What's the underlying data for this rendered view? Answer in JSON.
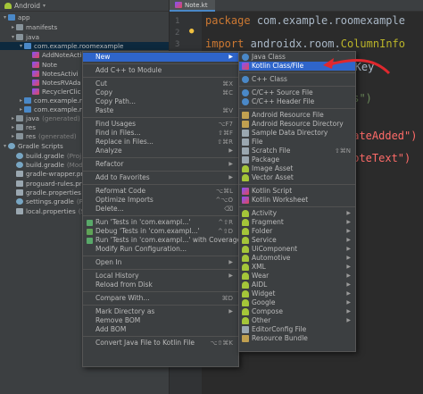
{
  "project": {
    "header": "Android",
    "tree": [
      {
        "label": "app",
        "level": 0
      },
      {
        "label": "manifests",
        "level": 1
      },
      {
        "label": "java",
        "level": 1
      },
      {
        "label": "com.example.roomexample",
        "level": 2
      },
      {
        "label": "AddNoteActi",
        "level": 3
      },
      {
        "label": "Note",
        "level": 3
      },
      {
        "label": "NotesActivi",
        "level": 3
      },
      {
        "label": "NotesRVAda",
        "level": 3
      },
      {
        "label": "RecyclerClic",
        "level": 3
      },
      {
        "label": "com.example.roo",
        "level": 2
      },
      {
        "label": "com.example.roo",
        "level": 2
      },
      {
        "label": "java",
        "suffix": "(generated)",
        "level": 1
      },
      {
        "label": "res",
        "level": 1
      },
      {
        "label": "res",
        "suffix": "(generated)",
        "level": 1
      },
      {
        "label": "Gradle Scripts",
        "level": 0
      },
      {
        "label": "build.gradle",
        "suffix": "(Proj",
        "level": 1
      },
      {
        "label": "build.gradle",
        "suffix": "(Modu",
        "level": 1
      },
      {
        "label": "gradle-wrapper.pr",
        "level": 1
      },
      {
        "label": "proguard-rules.pr",
        "level": 1
      },
      {
        "label": "gradle.properties",
        "level": 1
      },
      {
        "label": "settings.gradle",
        "suffix": "(Pr",
        "level": 1
      },
      {
        "label": "local.properties",
        "suffix": "(S",
        "level": 1
      }
    ]
  },
  "editor": {
    "tab": "Note.kt",
    "line_numbers": [
      "1",
      "2",
      "3"
    ],
    "code": {
      "pkg_kw": "package",
      "pkg_name": "com.example.roomexample",
      "import_kw": "import",
      "import_pkg": "androidx.room.",
      "import_cls": "ColumnInfo",
      "frag_ty": "ty",
      "frag_key": "aryKey",
      "frag_es": "es\")",
      "frag_date": "dateAdded\")",
      "frag_note": "noteText\")"
    }
  },
  "context_menu": {
    "items": [
      {
        "label": "New",
        "submenu": true,
        "active": true
      },
      {
        "sep": true
      },
      {
        "label": "Add C++ to Module"
      },
      {
        "sep": true
      },
      {
        "label": "Cut",
        "shortcut": "⌘X"
      },
      {
        "label": "Copy",
        "shortcut": "⌘C"
      },
      {
        "label": "Copy Path..."
      },
      {
        "label": "Paste",
        "shortcut": "⌘V"
      },
      {
        "sep": true
      },
      {
        "label": "Find Usages",
        "shortcut": "⌥F7"
      },
      {
        "label": "Find in Files...",
        "shortcut": "⇧⌘F"
      },
      {
        "label": "Replace in Files...",
        "shortcut": "⇧⌘R"
      },
      {
        "label": "Analyze",
        "submenu": true
      },
      {
        "sep": true
      },
      {
        "label": "Refactor",
        "submenu": true
      },
      {
        "sep": true
      },
      {
        "label": "Add to Favorites",
        "submenu": true
      },
      {
        "sep": true
      },
      {
        "label": "Reformat Code",
        "shortcut": "⌥⌘L"
      },
      {
        "label": "Optimize Imports",
        "shortcut": "^⌥O"
      },
      {
        "label": "Delete...",
        "shortcut": "⌫"
      },
      {
        "sep": true
      },
      {
        "label": "Run 'Tests in 'com.exampl...'",
        "shortcut": "^⇧R"
      },
      {
        "label": "Debug 'Tests in 'com.exampl...'",
        "shortcut": "^⇧D"
      },
      {
        "label": "Run 'Tests in 'com.exampl...' with Coverage"
      },
      {
        "label": "Modify Run Configuration..."
      },
      {
        "sep": true
      },
      {
        "label": "Open In",
        "submenu": true
      },
      {
        "sep": true
      },
      {
        "label": "Local History",
        "submenu": true
      },
      {
        "label": "Reload from Disk"
      },
      {
        "sep": true
      },
      {
        "label": "Compare With...",
        "shortcut": "⌘D"
      },
      {
        "sep": true
      },
      {
        "label": "Mark Directory as",
        "submenu": true
      },
      {
        "label": "Remove BOM"
      },
      {
        "label": "Add BOM"
      },
      {
        "sep": true
      },
      {
        "label": "Convert Java File to Kotlin File",
        "shortcut": "⌥⇧⌘K"
      }
    ]
  },
  "submenu": {
    "items": [
      {
        "label": "Java Class",
        "icon": "java-class-icon"
      },
      {
        "label": "Kotlin Class/File",
        "icon": "kotlin-icon",
        "active": true
      },
      {
        "sep": true
      },
      {
        "label": "C++ Class",
        "icon": "cpp-class-icon"
      },
      {
        "sep": true
      },
      {
        "label": "C/C++ Source File",
        "icon": "cpp-source-icon"
      },
      {
        "label": "C/C++ Header File",
        "icon": "cpp-header-icon"
      },
      {
        "sep": true
      },
      {
        "label": "Android Resource File",
        "icon": "resource-file-icon"
      },
      {
        "label": "Android Resource Directory",
        "icon": "resource-folder-icon"
      },
      {
        "label": "Sample Data Directory",
        "icon": "folder-icon"
      },
      {
        "label": "File",
        "icon": "file-icon"
      },
      {
        "label": "Scratch File",
        "shortcut": "⇧⌘N",
        "icon": "scratch-icon"
      },
      {
        "label": "Package",
        "icon": "package-icon"
      },
      {
        "label": "Image Asset",
        "icon": "image-icon"
      },
      {
        "label": "Vector Asset",
        "icon": "vector-icon"
      },
      {
        "sep": true
      },
      {
        "label": "Kotlin Script",
        "icon": "kotlin-icon"
      },
      {
        "label": "Kotlin Worksheet",
        "icon": "kotlin-icon"
      },
      {
        "sep": true
      },
      {
        "label": "Activity",
        "icon": "android-icon",
        "submenu": true
      },
      {
        "label": "Fragment",
        "icon": "android-icon",
        "submenu": true
      },
      {
        "label": "Folder",
        "icon": "android-icon",
        "submenu": true
      },
      {
        "label": "Service",
        "icon": "android-icon",
        "submenu": true
      },
      {
        "label": "UiComponent",
        "icon": "android-icon",
        "submenu": true
      },
      {
        "label": "Automotive",
        "icon": "android-icon",
        "submenu": true
      },
      {
        "label": "XML",
        "icon": "android-icon",
        "submenu": true
      },
      {
        "label": "Wear",
        "icon": "android-icon",
        "submenu": true
      },
      {
        "label": "AIDL",
        "icon": "android-icon",
        "submenu": true
      },
      {
        "label": "Widget",
        "icon": "android-icon",
        "submenu": true
      },
      {
        "label": "Google",
        "icon": "android-icon",
        "submenu": true
      },
      {
        "label": "Compose",
        "icon": "android-icon",
        "submenu": true
      },
      {
        "label": "Other",
        "icon": "android-icon",
        "submenu": true
      },
      {
        "label": "EditorConfig File",
        "icon": "editorconfig-icon"
      },
      {
        "label": "Resource Bundle",
        "icon": "bundle-icon"
      }
    ]
  },
  "colors": {
    "accent": "#2f65ca",
    "annotation": "#e0282e"
  }
}
